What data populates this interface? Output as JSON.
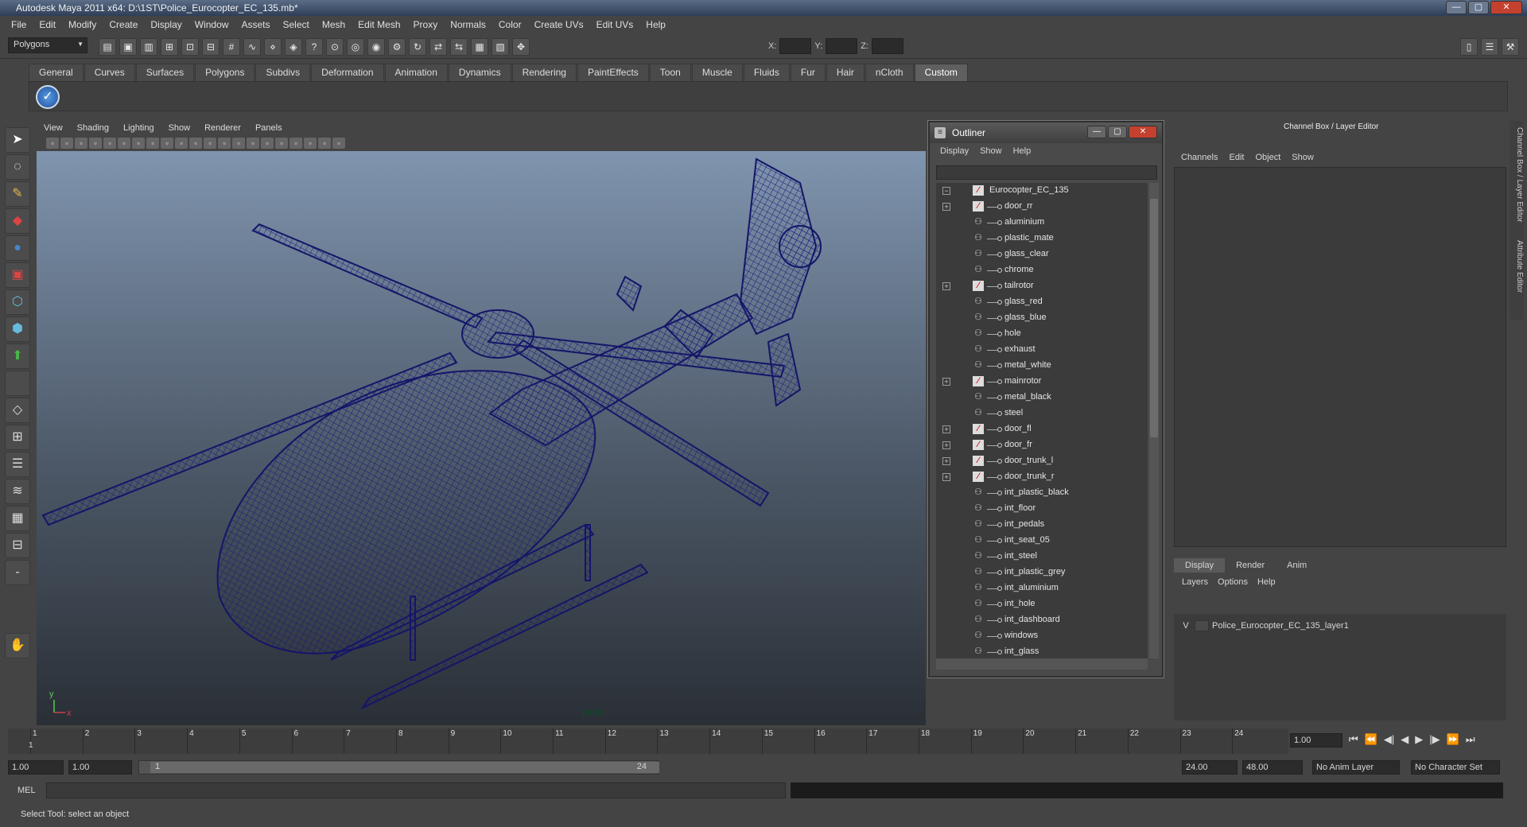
{
  "window": {
    "title": "Autodesk Maya 2011 x64: D:\\1ST\\Police_Eurocopter_EC_135.mb*",
    "controls": [
      "—",
      "▢",
      "✕"
    ]
  },
  "menubar": [
    "File",
    "Edit",
    "Modify",
    "Create",
    "Display",
    "Window",
    "Assets",
    "Select",
    "Mesh",
    "Edit Mesh",
    "Proxy",
    "Normals",
    "Color",
    "Create UVs",
    "Edit UVs",
    "Help"
  ],
  "statusline": {
    "mode": "Polygons",
    "x_label": "X:",
    "y_label": "Y:",
    "z_label": "Z:"
  },
  "shelf": {
    "tabs": [
      "General",
      "Curves",
      "Surfaces",
      "Polygons",
      "Subdivs",
      "Deformation",
      "Animation",
      "Dynamics",
      "Rendering",
      "PaintEffects",
      "Toon",
      "Muscle",
      "Fluids",
      "Fur",
      "Hair",
      "nCloth",
      "Custom"
    ],
    "active_tab": "Custom"
  },
  "viewport": {
    "menu": [
      "View",
      "Shading",
      "Lighting",
      "Show",
      "Renderer",
      "Panels"
    ],
    "camera_label": "persp",
    "axis_y": "y",
    "axis_x": "x"
  },
  "outliner": {
    "title": "Outliner",
    "menu": [
      "Display",
      "Show",
      "Help"
    ],
    "items": [
      {
        "name": "Eurocopter_EC_135",
        "type": "group",
        "expand": "−",
        "root": true
      },
      {
        "name": "door_rr",
        "type": "group",
        "expand": "+"
      },
      {
        "name": "aluminium",
        "type": "mesh",
        "expand": ""
      },
      {
        "name": "plastic_mate",
        "type": "mesh",
        "expand": ""
      },
      {
        "name": "glass_clear",
        "type": "mesh",
        "expand": ""
      },
      {
        "name": "chrome",
        "type": "mesh",
        "expand": ""
      },
      {
        "name": "tailrotor",
        "type": "group",
        "expand": "+"
      },
      {
        "name": "glass_red",
        "type": "mesh",
        "expand": ""
      },
      {
        "name": "glass_blue",
        "type": "mesh",
        "expand": ""
      },
      {
        "name": "hole",
        "type": "mesh",
        "expand": ""
      },
      {
        "name": "exhaust",
        "type": "mesh",
        "expand": ""
      },
      {
        "name": "metal_white",
        "type": "mesh",
        "expand": ""
      },
      {
        "name": "mainrotor",
        "type": "group",
        "expand": "+"
      },
      {
        "name": "metal_black",
        "type": "mesh",
        "expand": ""
      },
      {
        "name": "steel",
        "type": "mesh",
        "expand": ""
      },
      {
        "name": "door_fl",
        "type": "group",
        "expand": "+"
      },
      {
        "name": "door_fr",
        "type": "group",
        "expand": "+"
      },
      {
        "name": "door_trunk_l",
        "type": "group",
        "expand": "+"
      },
      {
        "name": "door_trunk_r",
        "type": "group",
        "expand": "+"
      },
      {
        "name": "int_plastic_black",
        "type": "mesh",
        "expand": ""
      },
      {
        "name": "int_floor",
        "type": "mesh",
        "expand": ""
      },
      {
        "name": "int_pedals",
        "type": "mesh",
        "expand": ""
      },
      {
        "name": "int_seat_05",
        "type": "mesh",
        "expand": ""
      },
      {
        "name": "int_steel",
        "type": "mesh",
        "expand": ""
      },
      {
        "name": "int_plastic_grey",
        "type": "mesh",
        "expand": ""
      },
      {
        "name": "int_aluminium",
        "type": "mesh",
        "expand": ""
      },
      {
        "name": "int_hole",
        "type": "mesh",
        "expand": ""
      },
      {
        "name": "int_dashboard",
        "type": "mesh",
        "expand": ""
      },
      {
        "name": "windows",
        "type": "mesh",
        "expand": ""
      },
      {
        "name": "int_glass",
        "type": "mesh",
        "expand": ""
      }
    ]
  },
  "channel_box": {
    "title": "Channel Box / Layer Editor",
    "menu": [
      "Channels",
      "Edit",
      "Object",
      "Show"
    ],
    "layer_tabs": [
      "Display",
      "Render",
      "Anim"
    ],
    "layer_menu": [
      "Layers",
      "Options",
      "Help"
    ],
    "layer": {
      "visible": "V",
      "name": "Police_Eurocopter_EC_135_layer1"
    },
    "side_tab": "Channel Box / Layer Editor",
    "side_tab2": "Attribute Editor"
  },
  "timeline": {
    "ticks": [
      "1",
      "2",
      "3",
      "4",
      "5",
      "6",
      "7",
      "8",
      "9",
      "10",
      "11",
      "12",
      "13",
      "14",
      "15",
      "16",
      "17",
      "18",
      "19",
      "20",
      "21",
      "22",
      "23",
      "24"
    ],
    "current_marker": "1",
    "current_frame": "1.00"
  },
  "range": {
    "start": "1.00",
    "start2": "1.00",
    "slider_start": "1",
    "slider_end": "24",
    "end": "24.00",
    "end2": "48.00",
    "anim_layer": "No Anim Layer",
    "char_set": "No Character Set"
  },
  "command": {
    "label": "MEL"
  },
  "help_line": "Select Tool: select an object",
  "colors": {
    "wire": "#1a1a7a",
    "bg_top": "#7f94ae",
    "bg_bottom": "#2a2f36"
  }
}
